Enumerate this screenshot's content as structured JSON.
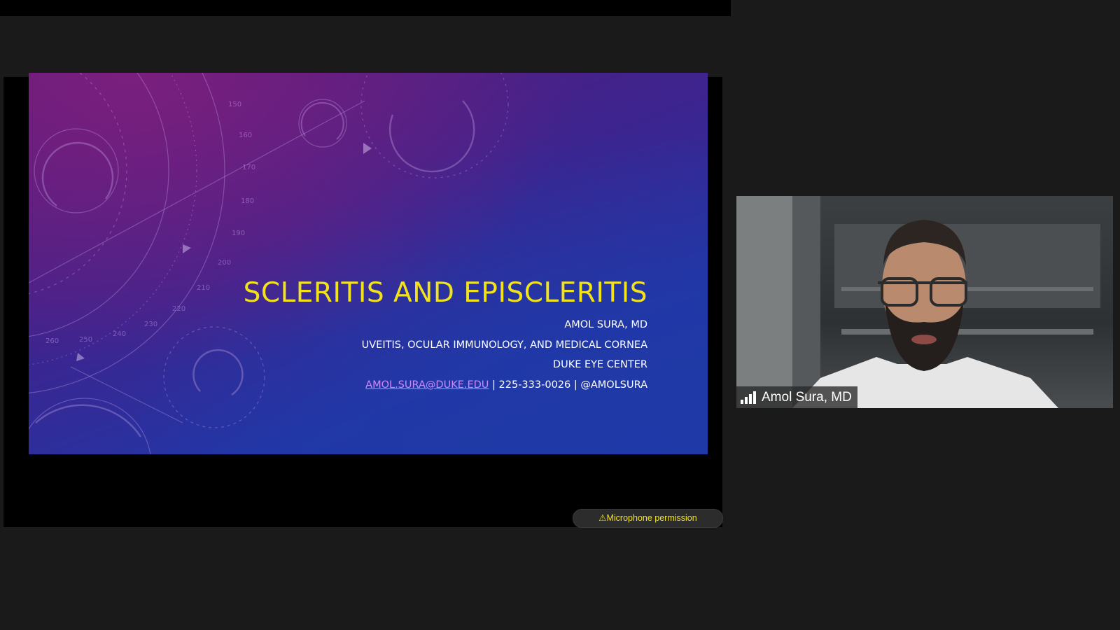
{
  "slide": {
    "title": "SCLERITIS AND EPISCLERITIS",
    "presenter": "AMOL SURA, MD",
    "department": "UVEITIS, OCULAR IMMUNOLOGY, AND MEDICAL CORNEA",
    "institution": "DUKE EYE CENTER",
    "email": "AMOL.SURA@DUKE.EDU",
    "contact_rest": " | 225-333-0026 | @AMOLSURA",
    "dial_numbers": [
      "150",
      "160",
      "170",
      "180",
      "190",
      "200",
      "210",
      "220",
      "230",
      "240",
      "250",
      "260"
    ]
  },
  "status": {
    "mic_warning_icon": "warning-icon",
    "mic_warning_symbol": "⚠",
    "mic_warning_text": "Microphone permission"
  },
  "participant": {
    "name": "Amol Sura, MD",
    "signal_icon": "signal-strength-icon"
  },
  "colors": {
    "title_yellow": "#f2e21a",
    "link_purple": "#c98bff",
    "app_background": "#1a1a1a"
  }
}
